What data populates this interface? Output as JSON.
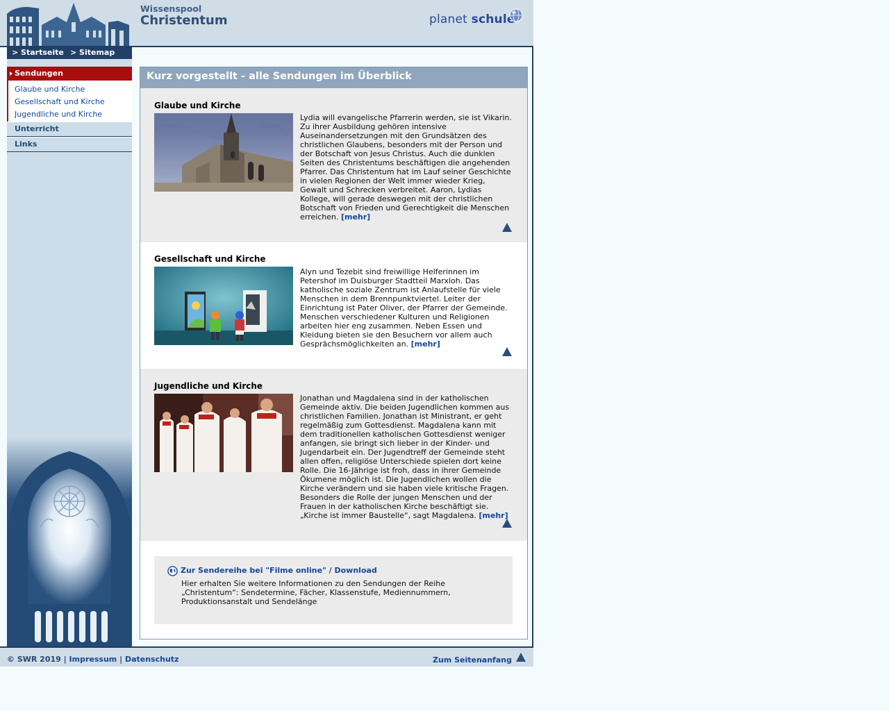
{
  "header": {
    "brand_small": "Wissenspool",
    "brand_title": "Christentum",
    "planet_light": "planet",
    "planet_bold": "schule"
  },
  "topnav": {
    "home": "> Startseite",
    "sitemap": "> Sitemap"
  },
  "sidebar": {
    "active_section": "Sendungen",
    "subitems": [
      "Glaube und Kirche",
      "Gesellschaft und Kirche",
      "Jugendliche und Kirche"
    ],
    "items": [
      "Unterricht",
      "Links"
    ]
  },
  "main": {
    "title": "Kurz vorgestellt - alle Sendungen im Überblick",
    "items": [
      {
        "heading": "Glaube und Kirche",
        "text": "Lydia will evangelische Pfarrerin werden, sie ist Vikarin. Zu ihrer Ausbildung gehören intensive Auseinandersetzungen mit den Grundsätzen des christlichen Glaubens, besonders mit der Person und der Botschaft von Jesus Christus. Auch die dunklen Seiten des Christentums beschäftigen die angehenden Pfarrer. Das Christentum hat im Lauf seiner Geschichte in vielen Regionen der Welt immer wieder Krieg, Gewalt und Schrecken verbreitet. Aaron, Lydias Kollege, will gerade deswegen mit der christlichen Botschaft von Frieden und Gerechtigkeit die Menschen erreichen.",
        "more": "[mehr]"
      },
      {
        "heading": "Gesellschaft und Kirche",
        "text": "Alyn und Tezebit sind freiwillige Helferinnen im Petershof im Duisburger Stadtteil Marxloh. Das katholische soziale Zentrum ist Anlaufstelle für viele Menschen in dem Brennpunktviertel. Leiter der Einrichtung ist Pater Oliver, der Pfarrer der Gemeinde. Menschen verschiedener Kulturen und Religionen arbeiten hier eng zusammen. Neben Essen und Kleidung bieten sie den Besuchern vor allem auch Gesprächsmöglichkeiten an.",
        "more": "[mehr]"
      },
      {
        "heading": "Jugendliche und Kirche",
        "text": "Jonathan und Magdalena sind in der katholischen Gemeinde aktiv. Die beiden Jugendlichen kommen aus christlichen Familien. Jonathan ist Ministrant, er geht regelmäßig zum Gottesdienst. Magdalena kann mit dem traditionellen katholischen Gottesdienst weniger anfangen, sie bringt sich lieber in der Kinder- und Jugendarbeit ein. Der Jugendtreff der Gemeinde steht allen offen, religiöse Unterschiede spielen dort keine Rolle. Die 16-Jährige ist froh, dass in ihrer Gemeinde Ökumene möglich ist. Die Jugendlichen wollen die Kirche verändern und sie haben viele kritische Fragen. Besonders die Rolle der jungen Menschen und der Frauen in der katholischen Kirche beschäftigt sie. „Kirche ist immer Baustelle“, sagt Magdalena.",
        "more": "[mehr]"
      }
    ],
    "infobox": {
      "link": "Zur Sendereihe bei \"Filme online\" / Download",
      "desc": "Hier erhalten Sie weitere Informationen zu den Sendungen der Reihe „Christentum“: Sendetermine, Fächer, Klassenstufe, Mediennummern, Produktionsanstalt und Sendelänge"
    }
  },
  "footer": {
    "copyright": "© SWR 2019",
    "sep": "|",
    "impressum": "Impressum",
    "datenschutz": "Datenschutz",
    "to_top": "Zum Seitenanfang"
  },
  "colors": {
    "header_bg": "#d1dde6",
    "navy": "#1f3f64",
    "active_red": "#a90d0c",
    "link_blue": "#13479a",
    "panel_title_bg": "#8fa6bd"
  }
}
